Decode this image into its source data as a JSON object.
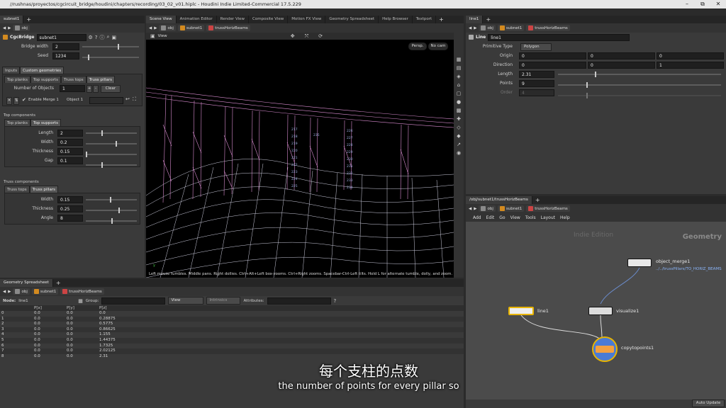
{
  "window": {
    "title": "//rushnas/proyectos/cgcircuit_bridge/houdini/chapters/recording/03_02_v01.hiplc - Houdini Indie Limited-Commercial 17.5.229",
    "min": "–",
    "max": "⧉",
    "close": "✕"
  },
  "left_params": {
    "tab": "subnet1",
    "path": "obj",
    "node_type": "CgcBridge",
    "node_name": "subnet1",
    "fields": [
      {
        "label": "Bridge width",
        "value": "2"
      },
      {
        "label": "Seed",
        "value": "1234"
      }
    ],
    "outer_tabs": [
      "Inputs",
      "Custom geometries"
    ],
    "inner_tabs": [
      "Top planks",
      "Top supports",
      "Truss tops",
      "Truss pillars"
    ],
    "num_objects_label": "Number of Objects",
    "num_objects": "1",
    "plus": "+",
    "minus": "-",
    "clear": "Clear",
    "enable_merge": "Enable Merge 1",
    "object_label": "Object 1",
    "top_components": {
      "title": "Top components",
      "tabs": [
        "Top planks",
        "Top supports"
      ],
      "fields": [
        {
          "label": "Length",
          "value": "2"
        },
        {
          "label": "Width",
          "value": "0.2"
        },
        {
          "label": "Thickness",
          "value": "0.15"
        },
        {
          "label": "Gap",
          "value": "0.1"
        }
      ]
    },
    "truss_components": {
      "title": "Truss components",
      "tabs": [
        "Truss tops",
        "Truss pillars"
      ],
      "fields": [
        {
          "label": "Width",
          "value": "0.15"
        },
        {
          "label": "Thickness",
          "value": "0.25"
        },
        {
          "label": "Angle",
          "value": "8"
        }
      ]
    }
  },
  "viewport": {
    "tabs": [
      "Scene View",
      "Animation Editor",
      "Render View",
      "Composite View",
      "Motion FX View",
      "Geometry Spreadsheet",
      "Help Browser",
      "Textport"
    ],
    "path": [
      "obj",
      "subnet1",
      "trussHorizBeams"
    ],
    "title": "View",
    "persp": "Persp.",
    "cam": "No cam",
    "status": "Left mouse tumbles. Middle pans. Right dollies. Ctrl+Alt+Left box-zooms. Ctrl+Right zooms. Spacebar-Ctrl-Left tilts. Hold L for alternate tumble, dolly, and zoom.",
    "axis": "y",
    "point_labels": [
      "217",
      "218",
      "219",
      "220",
      "221",
      "222",
      "223",
      "224",
      "225",
      "226",
      "227",
      "228",
      "229",
      "230",
      "231",
      "232",
      "233",
      "234",
      "235"
    ]
  },
  "right_params": {
    "tab": "line1",
    "path": [
      "obj",
      "subnet1",
      "trussHorizBeams"
    ],
    "node_type": "Line",
    "node_name": "line1",
    "primitive_type_label": "Primitive Type",
    "primitive_type": "Polygon",
    "origin": {
      "label": "Origin",
      "values": [
        "0",
        "0",
        "0"
      ]
    },
    "direction": {
      "label": "Direction",
      "values": [
        "0",
        "0",
        "1"
      ]
    },
    "length": {
      "label": "Length",
      "value": "2.31"
    },
    "points": {
      "label": "Points",
      "value": "9"
    },
    "order": {
      "label": "Order",
      "value": "4"
    }
  },
  "network": {
    "tab": "/obj/subnet1/trussHorizBeams",
    "path": [
      "obj",
      "subnet1",
      "trussHorizBeams"
    ],
    "menu": [
      "Add",
      "Edit",
      "Go",
      "View",
      "Tools",
      "Layout",
      "Help"
    ],
    "watermark": "Indie Edition",
    "context": "Geometry",
    "nodes": [
      {
        "name": "object_merge1",
        "sub": "../../trussPillars/TO_HORIZ_BEAMS"
      },
      {
        "name": "line1"
      },
      {
        "name": "visualize1"
      },
      {
        "name": "copytopoints1"
      }
    ],
    "auto_update": "Auto Update"
  },
  "spreadsheet": {
    "tab": "Geometry Spreadsheet",
    "path": [
      "obj",
      "subnet1",
      "trussHorizBeams"
    ],
    "node_label": "Node:",
    "node": "line1",
    "group_label": "Group:",
    "view": "View",
    "intrinsics": "Intrinsics",
    "attributes_label": "Attributes:",
    "columns": [
      "",
      "P[x]",
      "P[y]",
      "P[z]"
    ],
    "rows": [
      [
        "0",
        "0.0",
        "0.0",
        "0.0"
      ],
      [
        "1",
        "0.0",
        "0.0",
        "0.28875"
      ],
      [
        "2",
        "0.0",
        "0.0",
        "0.5775"
      ],
      [
        "3",
        "0.0",
        "0.0",
        "0.86625"
      ],
      [
        "4",
        "0.0",
        "0.0",
        "1.155"
      ],
      [
        "5",
        "0.0",
        "0.0",
        "1.44375"
      ],
      [
        "6",
        "0.0",
        "0.0",
        "1.7325"
      ],
      [
        "7",
        "0.0",
        "0.0",
        "2.02125"
      ],
      [
        "8",
        "0.0",
        "0.0",
        "2.31"
      ]
    ]
  },
  "subtitles": {
    "zh": "每个支柱的点数",
    "en": "the number of points for every pillar so"
  }
}
